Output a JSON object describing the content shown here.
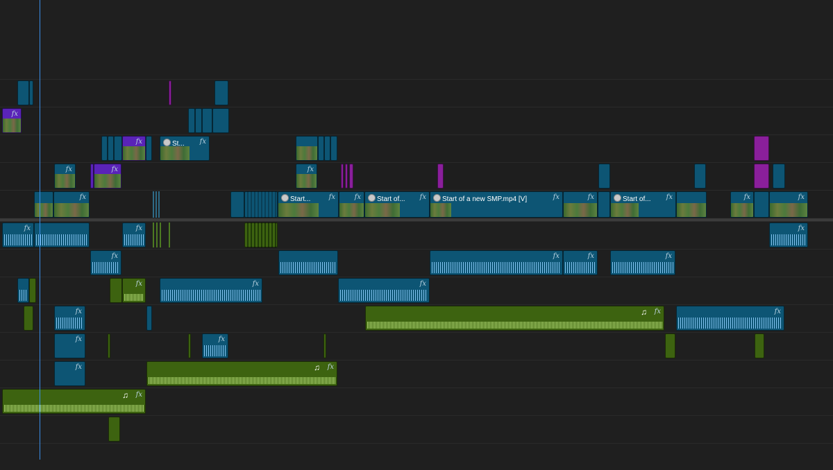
{
  "timeline": {
    "playhead_label": "",
    "video_clip_names": [
      "St...",
      "Start...",
      "Start of...",
      "Start of a new SMP.mp4 [V]",
      "Start of..."
    ],
    "fx_label": "fx",
    "music_icon": "♫",
    "voice_icon": "speaker-icon",
    "colors": {
      "background": "#1e1e1e",
      "video_clip": "#0d5574",
      "adjustment_clip": "#5a23b8",
      "magenta_clip": "#8a1f9b",
      "music_clip": "#3d6310",
      "waveform_blue": "#8fd0ff",
      "waveform_green": "#b9e27a",
      "playhead": "#3a8ee8"
    }
  }
}
